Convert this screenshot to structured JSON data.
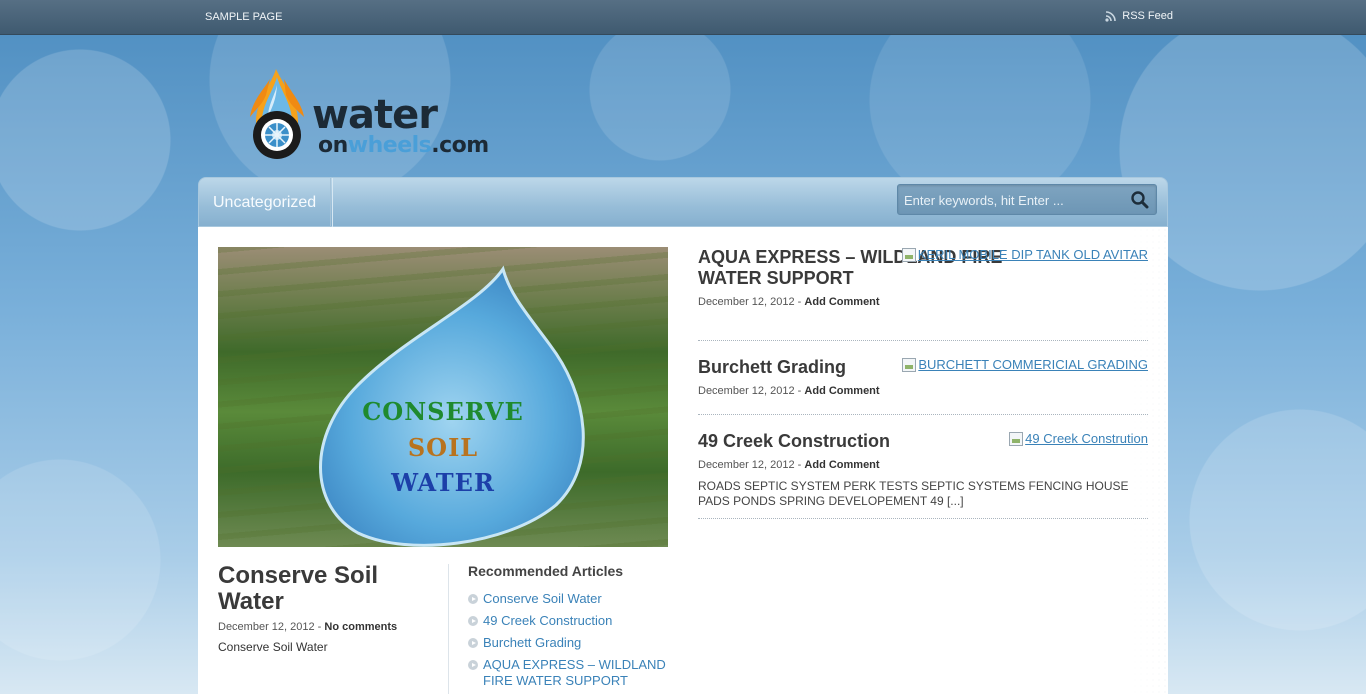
{
  "topbar": {
    "nav_link": "SAMPLE PAGE",
    "rss_label": "RSS Feed"
  },
  "logo": {
    "main": "water",
    "sub_on": "on",
    "sub_wheels": "wheels",
    "sub_com": ".com"
  },
  "navbar": {
    "item": "Uncategorized",
    "search_placeholder": "Enter keywords, hit Enter ..."
  },
  "feature": {
    "image_lines": [
      "CONSERVE",
      "SOIL",
      "WATER"
    ],
    "title": "Conserve Soil Water",
    "date": "December 12, 2012",
    "sep": " - ",
    "comments": "No comments",
    "excerpt": "Conserve Soil Water"
  },
  "recommended": {
    "heading": "Recommended Articles",
    "items": [
      "Conserve Soil Water",
      "49 Creek Construction",
      "Burchett Grading",
      "AQUA EXPRESS – WILDLAND FIRE WATER SUPPORT"
    ]
  },
  "posts": [
    {
      "title": "AQUA EXPRESS – WILDLAND FIRE WATER SUPPORT",
      "date": "December 12, 2012",
      "sep": " - ",
      "comments": "Add Comment",
      "image_alt": "KERIL MOBILE DIP TANK OLD AVITAR"
    },
    {
      "title": "Burchett Grading",
      "date": "December 12, 2012",
      "sep": " - ",
      "comments": "Add Comment",
      "image_alt": "BURCHETT COMMERICIAL GRADING"
    },
    {
      "title": "49 Creek Construction",
      "date": "December 12, 2012",
      "sep": " - ",
      "comments": "Add Comment",
      "image_alt": "49 Creek Constrution",
      "excerpt": "ROADS SEPTIC SYSTEM PERK TESTS SEPTIC SYSTEMS FENCING HOUSE PADS PONDS SPRING DEVELOPEMENT 49 [...]"
    }
  ],
  "colors": {
    "link": "#3a82b8",
    "topbar": "#4a6479",
    "background": "#5a98c8"
  }
}
